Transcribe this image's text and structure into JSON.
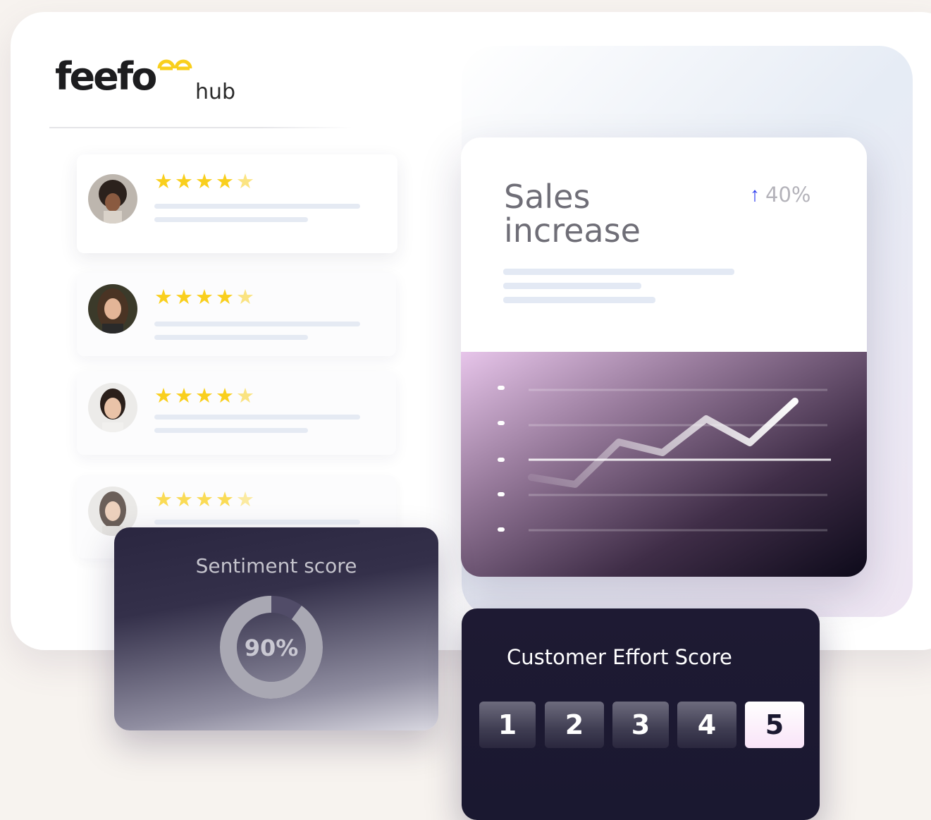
{
  "brand": {
    "name": "feefo",
    "product": "hub",
    "accent": "#f9cf1d"
  },
  "reviews": [
    {
      "rating": 4.5,
      "stars": "★★★★",
      "half": "★"
    },
    {
      "rating": 4.5,
      "stars": "★★★★",
      "half": "★"
    },
    {
      "rating": 4.5,
      "stars": "★★★★",
      "half": "★"
    },
    {
      "rating": 4.5,
      "stars": "★★★★",
      "half": "★"
    }
  ],
  "sales_card": {
    "title": "Sales increase",
    "change_icon": "arrow-up-icon",
    "change_arrow": "↑",
    "change_value": "40%"
  },
  "sentiment": {
    "title": "Sentiment score",
    "value_label": "90%",
    "value": 0.9
  },
  "ces": {
    "title": "Customer Effort Score",
    "options": [
      "1",
      "2",
      "3",
      "4",
      "5"
    ],
    "selected": "5"
  },
  "colors": {
    "star": "#f9cf1d",
    "arrow": "#2a3af0",
    "dark_card": "#1e1a33"
  }
}
